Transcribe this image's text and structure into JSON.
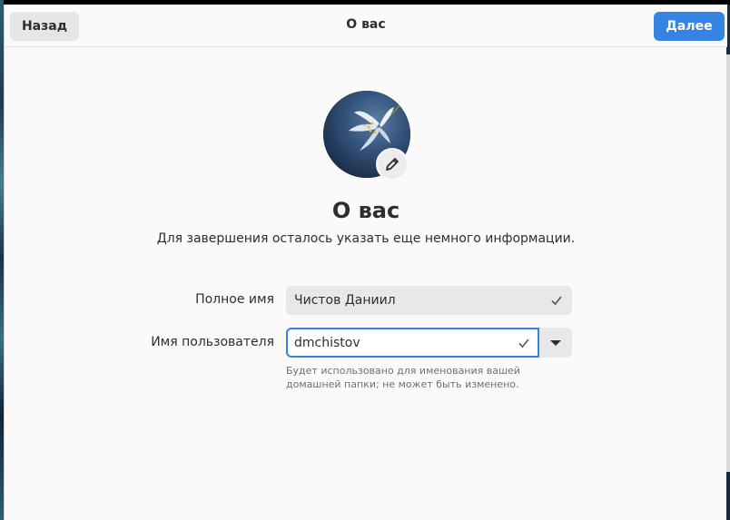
{
  "header": {
    "back_label": "Назад",
    "title": "О вас",
    "next_label": "Далее"
  },
  "page": {
    "title": "О вас",
    "subtitle": "Для завершения осталось указать еще немного информации."
  },
  "form": {
    "full_name": {
      "label": "Полное имя",
      "value": "Чистов Даниил"
    },
    "username": {
      "label": "Имя пользователя",
      "value": "dmchistov",
      "hint": "Будет использовано для именования вашей домашней папки; не может быть изменено."
    }
  },
  "colors": {
    "accent": "#3584e4",
    "background": "#fafafa",
    "field": "#e8e8e8"
  },
  "icons": {
    "avatar_edit": "pencil-icon",
    "valid": "checkmark-icon",
    "dropdown": "triangle-down-icon"
  }
}
